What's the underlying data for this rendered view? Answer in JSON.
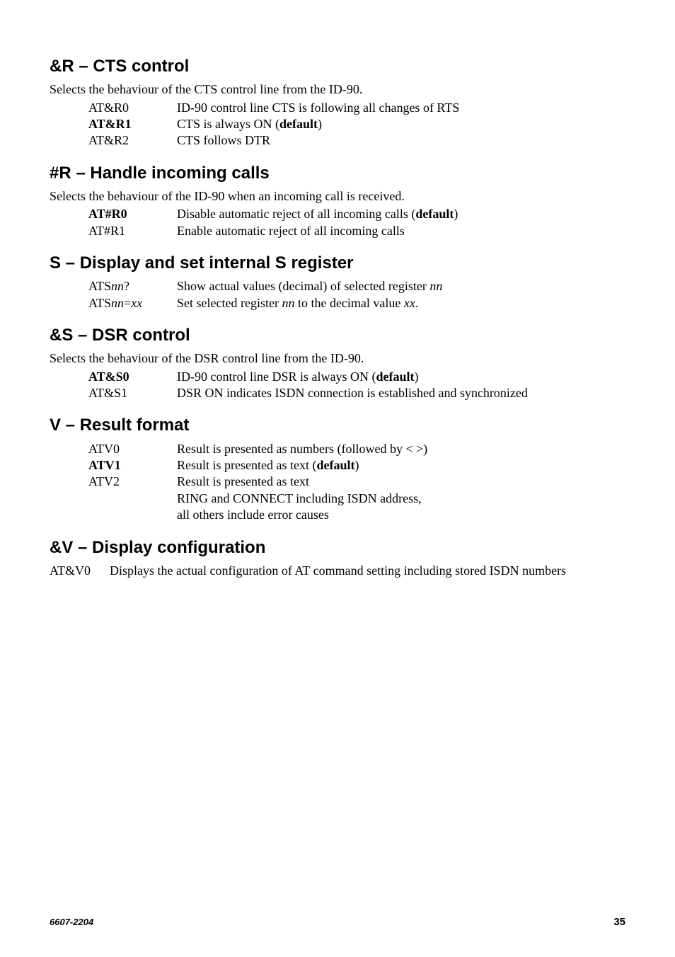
{
  "sections": {
    "cr": {
      "heading": "&R – CTS control",
      "intro": "Selects the behaviour of the CTS control line from the ID-90.",
      "rows": [
        {
          "term": "AT&R0",
          "desc": "ID-90 control line CTS is following all changes of RTS"
        },
        {
          "term": "AT&R1",
          "desc_plain_pre": "CTS is always ON (",
          "desc_bold": "default",
          "desc_plain_post": ")"
        },
        {
          "term": "AT&R2",
          "desc": "CTS follows DTR"
        }
      ]
    },
    "hr": {
      "heading": "#R – Handle incoming calls",
      "intro": "Selects the behaviour of the ID-90 when an incoming call is received.",
      "rows": [
        {
          "term": "AT#R0",
          "desc_plain_pre": "Disable automatic reject of all incoming calls (",
          "desc_bold": "default",
          "desc_plain_post": ")"
        },
        {
          "term": "AT#R1",
          "desc": "Enable automatic reject of all incoming calls"
        }
      ]
    },
    "sreg": {
      "heading": "S – Display and set internal S register",
      "rows": [
        {
          "term_pre": "ATS",
          "term_it1": "nn",
          "term_post1": "?",
          "desc_pre": "Show actual values (decimal) of selected register ",
          "desc_it": "nn",
          "desc_post": ""
        },
        {
          "term_pre": "ATS",
          "term_it1": "nn",
          "term_mid": "=",
          "term_it2": "xx",
          "desc_pre": "Set selected register ",
          "desc_it": "nn",
          "desc_mid": " to the decimal value ",
          "desc_it2": "xx",
          "desc_post": "."
        }
      ]
    },
    "ds": {
      "heading": "&S – DSR control",
      "intro": "Selects the behaviour of the DSR control line from the ID-90.",
      "rows": [
        {
          "term": "AT&S0",
          "desc_plain_pre": "ID-90 control line DSR is always ON (",
          "desc_bold": "default",
          "desc_plain_post": ")"
        },
        {
          "term": "AT&S1",
          "desc": "DSR ON indicates ISDN connection is established and synchronized"
        }
      ]
    },
    "vres": {
      "heading": "V – Result format",
      "rows": [
        {
          "term": "ATV0",
          "desc": "Result is presented as numbers (followed by <  >)"
        },
        {
          "term": "ATV1",
          "desc_plain_pre": "Result is presented as text (",
          "desc_bold": "default",
          "desc_plain_post": ")"
        },
        {
          "term": "ATV2",
          "desc": "Result is presented as text"
        },
        {
          "term": "",
          "desc": "RING and CONNECT including ISDN address,"
        },
        {
          "term": "",
          "desc": "all others include error causes"
        }
      ]
    },
    "cv": {
      "heading": "&V – Display configuration",
      "row": {
        "term": "AT&V0",
        "desc": "Displays the actual configuration of AT command setting including stored ISDN numbers"
      }
    }
  },
  "footer": {
    "left": "6607-2204",
    "right": "35"
  }
}
